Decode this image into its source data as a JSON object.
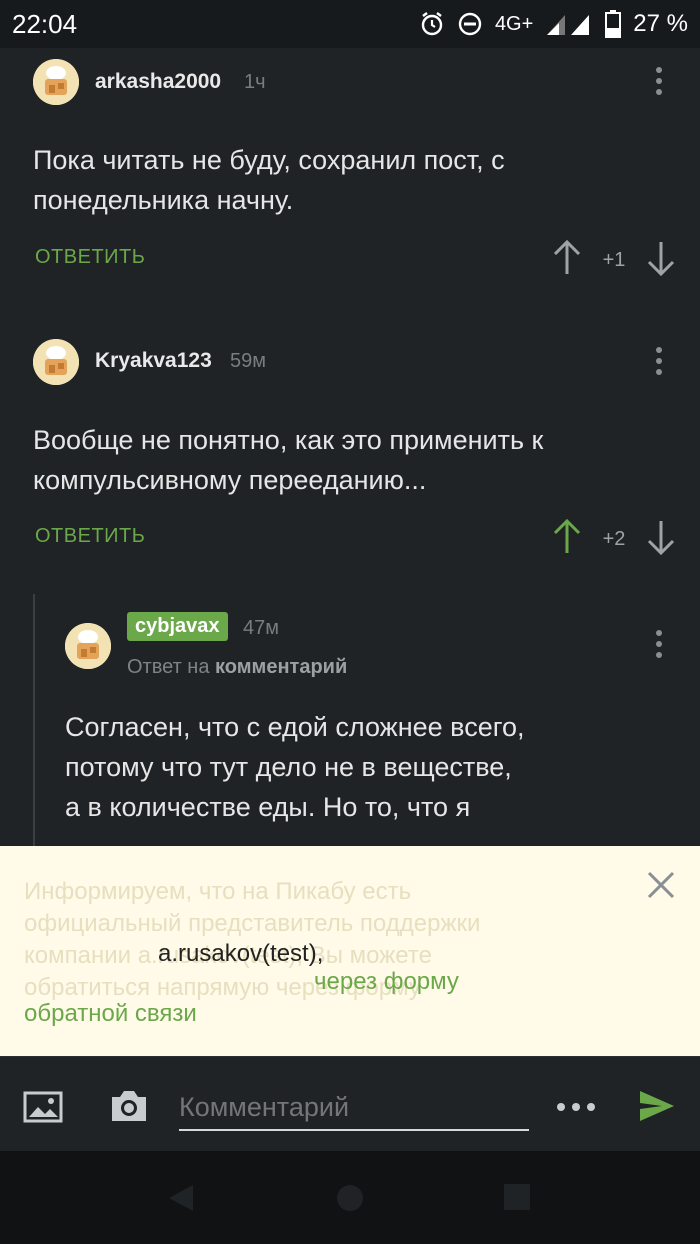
{
  "status_bar": {
    "time": "22:04",
    "network": "4G+",
    "battery": "27 %"
  },
  "comments": [
    {
      "author": "arkasha2000",
      "time": "1ч",
      "text_lines": [
        "Пока читать не буду, сохранил пост, с",
        "понедельника начну."
      ],
      "reply_label": "ОТВЕТИТЬ",
      "score": "+1",
      "upvoted": false
    },
    {
      "author": "Kryakva123",
      "time": "59м",
      "text_lines": [
        "Вообще не понятно, как это применить к",
        "компульсивному перееданию..."
      ],
      "reply_label": "ОТВЕТИТЬ",
      "score": "+2",
      "upvoted": true
    },
    {
      "author": "cybjavax",
      "time": "47м",
      "reply_prefix": "Ответ на",
      "reply_target": "комментарий",
      "text_lines": [
        "Согласен, что с едой сложнее всего,",
        "потому что тут дело не в веществе,",
        "а в количестве еды. Но то, что я"
      ]
    }
  ],
  "banner": {
    "ghost_lines": [
      "Информируем, что на Пикабу есть",
      "официальный представитель поддержки",
      "компании a.rusakov(test), Вы можете",
      "обратиться напрямую через форму"
    ],
    "username": "a.rusakov(test),",
    "link_part1": "через форму",
    "link_part2": "обратной связи"
  },
  "input": {
    "placeholder": "Комментарий"
  },
  "colors": {
    "background": "#1f2326",
    "accent_green": "#6ba84a",
    "banner_bg": "#fffbe8"
  },
  "icons": {
    "status": [
      "alarm-icon",
      "do-not-disturb-icon",
      "signal-icon",
      "battery-icon"
    ],
    "input_bar": [
      "image-icon",
      "camera-icon",
      "more-horizontal-icon",
      "send-icon"
    ],
    "nav": [
      "back-icon",
      "home-icon",
      "recents-icon"
    ]
  }
}
